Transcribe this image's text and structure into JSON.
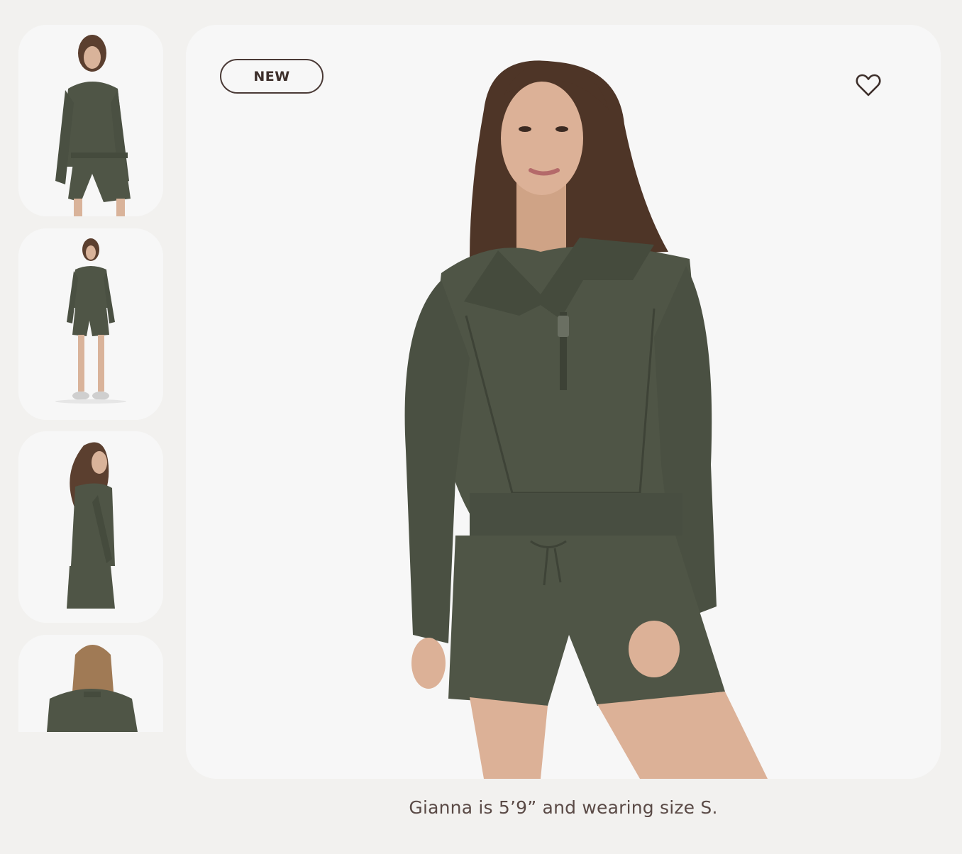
{
  "gallery": {
    "thumbnails": [
      {
        "alt": "front view thumbnail"
      },
      {
        "alt": "full body thumbnail"
      },
      {
        "alt": "side view thumbnail"
      },
      {
        "alt": "back view thumbnail"
      }
    ],
    "main_image": {
      "badge": "NEW",
      "favorite_icon": "heart-outline-icon"
    },
    "caption": "Gianna is 5’9” and wearing size S."
  },
  "colors": {
    "background": "#f2f1ef",
    "card": "#f7f7f7",
    "garment": "#4f5546",
    "text": "#5a4a46",
    "badge_border": "#4a3a36"
  }
}
